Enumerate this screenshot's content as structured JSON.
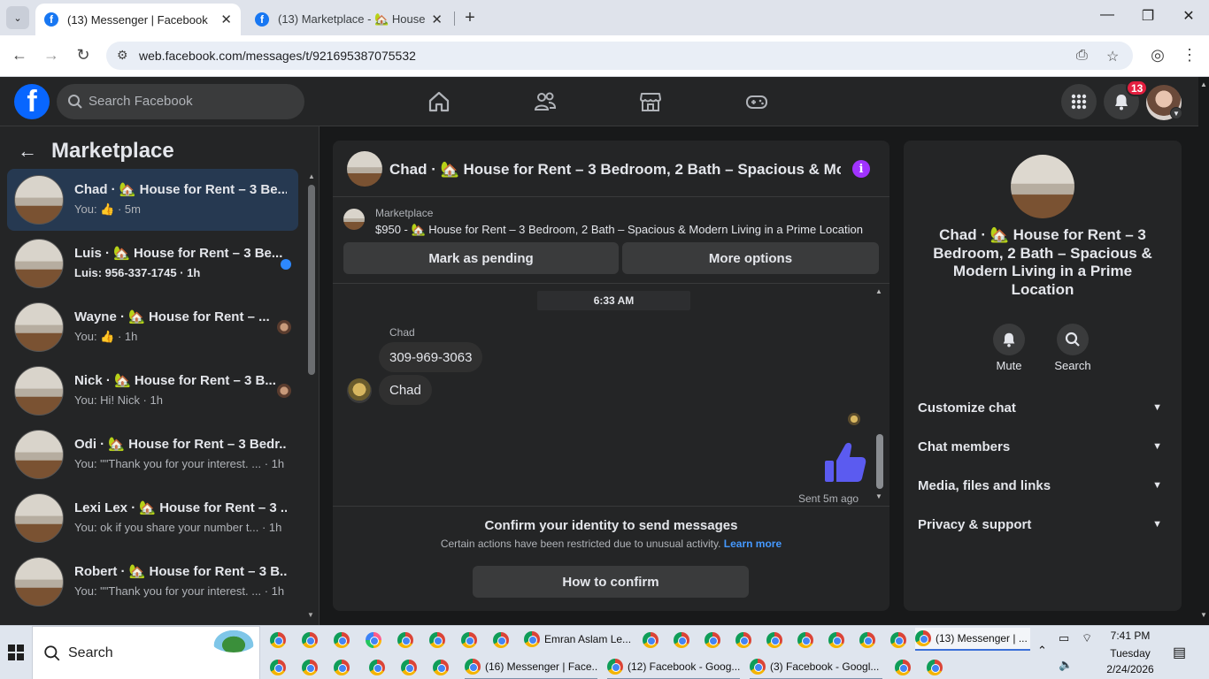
{
  "browser": {
    "tabs": [
      {
        "title": "(13) Messenger | Facebook",
        "active": true
      },
      {
        "title": "(13) Marketplace - 🏡 House fo",
        "active": false
      }
    ],
    "url": "web.facebook.com/messages/t/921695387075532"
  },
  "fb_header": {
    "search_placeholder": "Search Facebook",
    "notification_count": "13"
  },
  "left_panel": {
    "title": "Marketplace",
    "conversations": [
      {
        "name": "Chad · 🏡 House for Rent – 3 Be...",
        "preview": "You: 👍 · 5m",
        "selected": true
      },
      {
        "name": "Luis · 🏡 House for Rent – 3 Be...",
        "preview": "Luis: 956-337-1745 · 1h",
        "unread": true
      },
      {
        "name": "Wayne · 🏡 House for Rent – ...",
        "preview": "You: 👍 · 1h"
      },
      {
        "name": "Nick · 🏡 House for Rent – 3 B...",
        "preview": "You: Hi! Nick · 1h"
      },
      {
        "name": "Odi · 🏡 House for Rent – 3 Bedr...",
        "preview": "You: \"\"Thank you for your interest. ... · 1h"
      },
      {
        "name": "Lexi Lex · 🏡 House for Rent – 3 ...",
        "preview": "You: ok if you share your number t... · 1h"
      },
      {
        "name": "Robert · 🏡 House for Rent – 3 B...",
        "preview": "You: \"\"Thank you for your interest. ... · 1h"
      }
    ]
  },
  "chat": {
    "title": "Chad · 🏡 House for Rent – 3 Bedroom, 2 Bath – Spacious & Mo···",
    "marketplace_label": "Marketplace",
    "listing": "$950 - 🏡 House for Rent – 3 Bedroom, 2 Bath – Spacious & Modern Living in a Prime Location",
    "pending_button": "Mark as pending",
    "more_options_button": "More options",
    "time_separator": "6:33 AM",
    "sender": "Chad",
    "messages": [
      "309-969-3063",
      "Chad"
    ],
    "sent_status": "Sent 5m ago",
    "confirm_title": "Confirm your identity to send messages",
    "confirm_desc": "Certain actions have been restricted due to unusual activity.",
    "learn_more": "Learn more",
    "confirm_button": "How to confirm"
  },
  "info_panel": {
    "name": "Chad · 🏡 House for Rent – 3 Bedroom, 2 Bath – Spacious & Modern Living in a Prime Location",
    "mute_label": "Mute",
    "search_label": "Search",
    "sections": [
      "Customize chat",
      "Chat members",
      "Media, files and links",
      "Privacy & support"
    ]
  },
  "taskbar": {
    "search_placeholder": "Search",
    "items_top": [
      "Emran Aslam Le...",
      "(13) Messenger | ..."
    ],
    "items_bottom": [
      "(16) Messenger | Face...",
      "(12) Facebook - Goog...",
      "(3) Facebook - Googl..."
    ],
    "time": "7:41 PM",
    "day": "Tuesday",
    "date": "2/24/2026"
  },
  "colors": {
    "fb_blue": "#0866ff",
    "notification_red": "#e41e3f",
    "like_blue": "#5b5bf0",
    "info_purple": "#a033ff"
  }
}
